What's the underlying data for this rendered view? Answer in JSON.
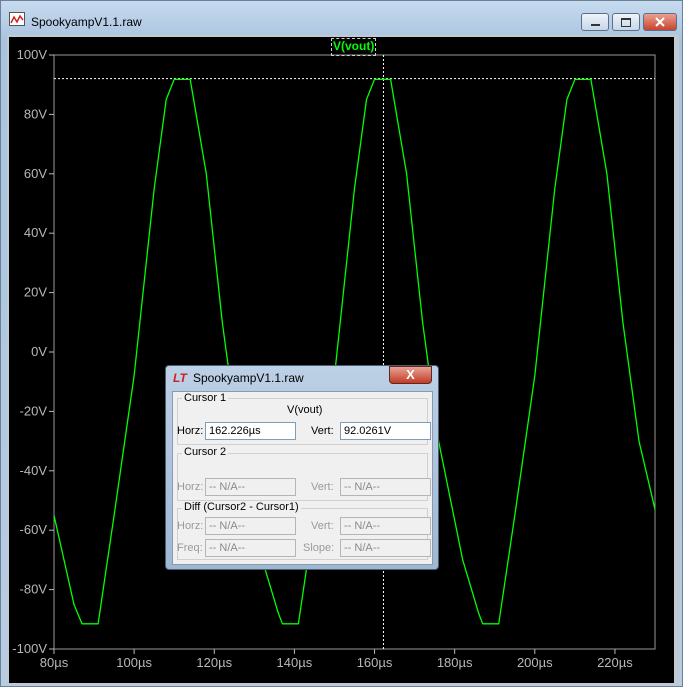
{
  "window": {
    "title": "SpookyampV1.1.raw",
    "min_icon": "minimize-icon",
    "max_icon": "maximize-icon",
    "close_icon": "close-icon"
  },
  "legend": {
    "trace": "V(vout)",
    "color": "#00ff00"
  },
  "chart_data": {
    "type": "line",
    "series": [
      {
        "name": "V(vout)",
        "color": "#00ff00",
        "points": [
          [
            80,
            -55
          ],
          [
            85,
            -85
          ],
          [
            87,
            -91.5
          ],
          [
            91,
            -91.5
          ],
          [
            95,
            -55
          ],
          [
            100,
            -8
          ],
          [
            105,
            55
          ],
          [
            108,
            85
          ],
          [
            110,
            91.8
          ],
          [
            114,
            91.8
          ],
          [
            118,
            60
          ],
          [
            122,
            10
          ],
          [
            126,
            -30
          ],
          [
            132,
            -70
          ],
          [
            136,
            -88
          ],
          [
            137,
            -91.5
          ],
          [
            141,
            -91.5
          ],
          [
            145,
            -55
          ],
          [
            150,
            -8
          ],
          [
            155,
            55
          ],
          [
            158,
            85
          ],
          [
            160,
            91.8
          ],
          [
            164,
            91.8
          ],
          [
            168,
            60
          ],
          [
            172,
            10
          ],
          [
            176,
            -30
          ],
          [
            182,
            -70
          ],
          [
            186,
            -88
          ],
          [
            187,
            -91.5
          ],
          [
            191,
            -91.5
          ],
          [
            195,
            -55
          ],
          [
            200,
            -8
          ],
          [
            205,
            55
          ],
          [
            208,
            85
          ],
          [
            210,
            91.8
          ],
          [
            214,
            91.8
          ],
          [
            218,
            60
          ],
          [
            222,
            10
          ],
          [
            226,
            -30
          ],
          [
            230,
            -53
          ]
        ]
      }
    ],
    "x_ticks": [
      "80µs",
      "100µs",
      "120µs",
      "140µs",
      "160µs",
      "180µs",
      "200µs",
      "220µs"
    ],
    "y_ticks": [
      "100V",
      "80V",
      "60V",
      "40V",
      "20V",
      "0V",
      "-20V",
      "-40V",
      "-60V",
      "-80V",
      "-100V"
    ],
    "xlim": [
      80,
      230
    ],
    "ylim": [
      -100,
      100
    ],
    "cursor": {
      "x": 162.226,
      "y": 92.0261
    },
    "grid": false,
    "background": "#000000"
  },
  "cursor_dialog": {
    "title": "SpookyampV1.1.raw",
    "close_label": "X",
    "cursor1_label": "Cursor 1",
    "trace_label": "V(vout)",
    "horz_label": "Horz:",
    "vert_label": "Vert:",
    "cursor1_horz": "162.226µs",
    "cursor1_vert": "92.0261V",
    "cursor2_label": "Cursor 2",
    "cursor2_horz": "-- N/A--",
    "cursor2_vert": "-- N/A--",
    "diff_label": "Diff (Cursor2 - Cursor1)",
    "diff_horz": "-- N/A--",
    "diff_vert": "-- N/A--",
    "freq_label": "Freq:",
    "slope_label": "Slope:",
    "diff_freq": "-- N/A--",
    "diff_slope": "-- N/A--"
  }
}
